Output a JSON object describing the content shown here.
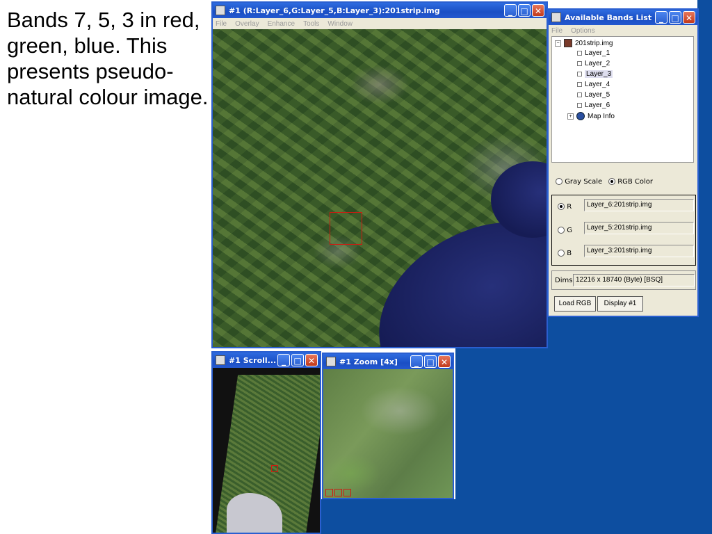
{
  "slide_text": "Bands 7, 5, 3 in red, green, blue. This presents pseudo-natural colour image.",
  "main_window": {
    "title": "#1 (R:Layer_6,G:Layer_5,B:Layer_3):201strip.img",
    "menu": [
      "File",
      "Overlay",
      "Enhance",
      "Tools",
      "Window"
    ]
  },
  "scroll_window": {
    "title": "#1 Scroll..."
  },
  "zoom_window": {
    "title": "#1 Zoom [4x]"
  },
  "bands_window": {
    "title": "Available Bands List",
    "menu": [
      "File",
      "Options"
    ],
    "tree": {
      "root": "201strip.img",
      "layers": [
        "Layer_1",
        "Layer_2",
        "Layer_3",
        "Layer_4",
        "Layer_5",
        "Layer_6"
      ],
      "selected_layer": "Layer_3",
      "map_info": "Map Info"
    },
    "mode_gray": "Gray Scale",
    "mode_rgb": "RGB Color",
    "selected_mode": "RGB Color",
    "channels": [
      {
        "label": "R",
        "value": "Layer_6:201strip.img",
        "selected": true
      },
      {
        "label": "G",
        "value": "Layer_5:201strip.img",
        "selected": false
      },
      {
        "label": "B",
        "value": "Layer_3:201strip.img",
        "selected": false
      }
    ],
    "dims_label": "Dims",
    "dims_value": "12216 x 18740 (Byte) [BSQ]",
    "load_button": "Load RGB",
    "display_button": "Display #1"
  },
  "window_buttons": {
    "minimize": "_",
    "maximize": "□",
    "close": "✕"
  },
  "colors": {
    "desktop": "#0d4ea0",
    "titlebar": "#1a4fc4",
    "window_bg": "#ece9d8",
    "roi_box": "#d01a10"
  }
}
